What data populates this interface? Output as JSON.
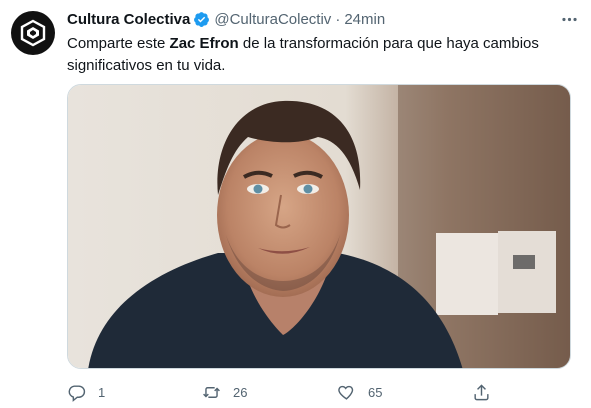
{
  "tweet": {
    "author_name": "Cultura Colectiva",
    "handle": "@CulturaColectiv",
    "separator": "·",
    "time": "24min",
    "text_before": "Comparte este ",
    "text_bold": "Zac Efron",
    "text_after": " de la transformación para que haya cambios significativos en tu vida.",
    "media_alt": "Zac Efron photo"
  },
  "actions": {
    "reply_count": "1",
    "retweet_count": "26",
    "like_count": "65"
  },
  "icons": {
    "verified": "verified-badge-icon",
    "more": "more-options-icon",
    "reply": "reply-icon",
    "retweet": "retweet-icon",
    "like": "heart-icon",
    "share": "share-icon"
  },
  "colors": {
    "verified": "#1d9bf0",
    "text": "#0f1419",
    "muted": "#536471"
  }
}
